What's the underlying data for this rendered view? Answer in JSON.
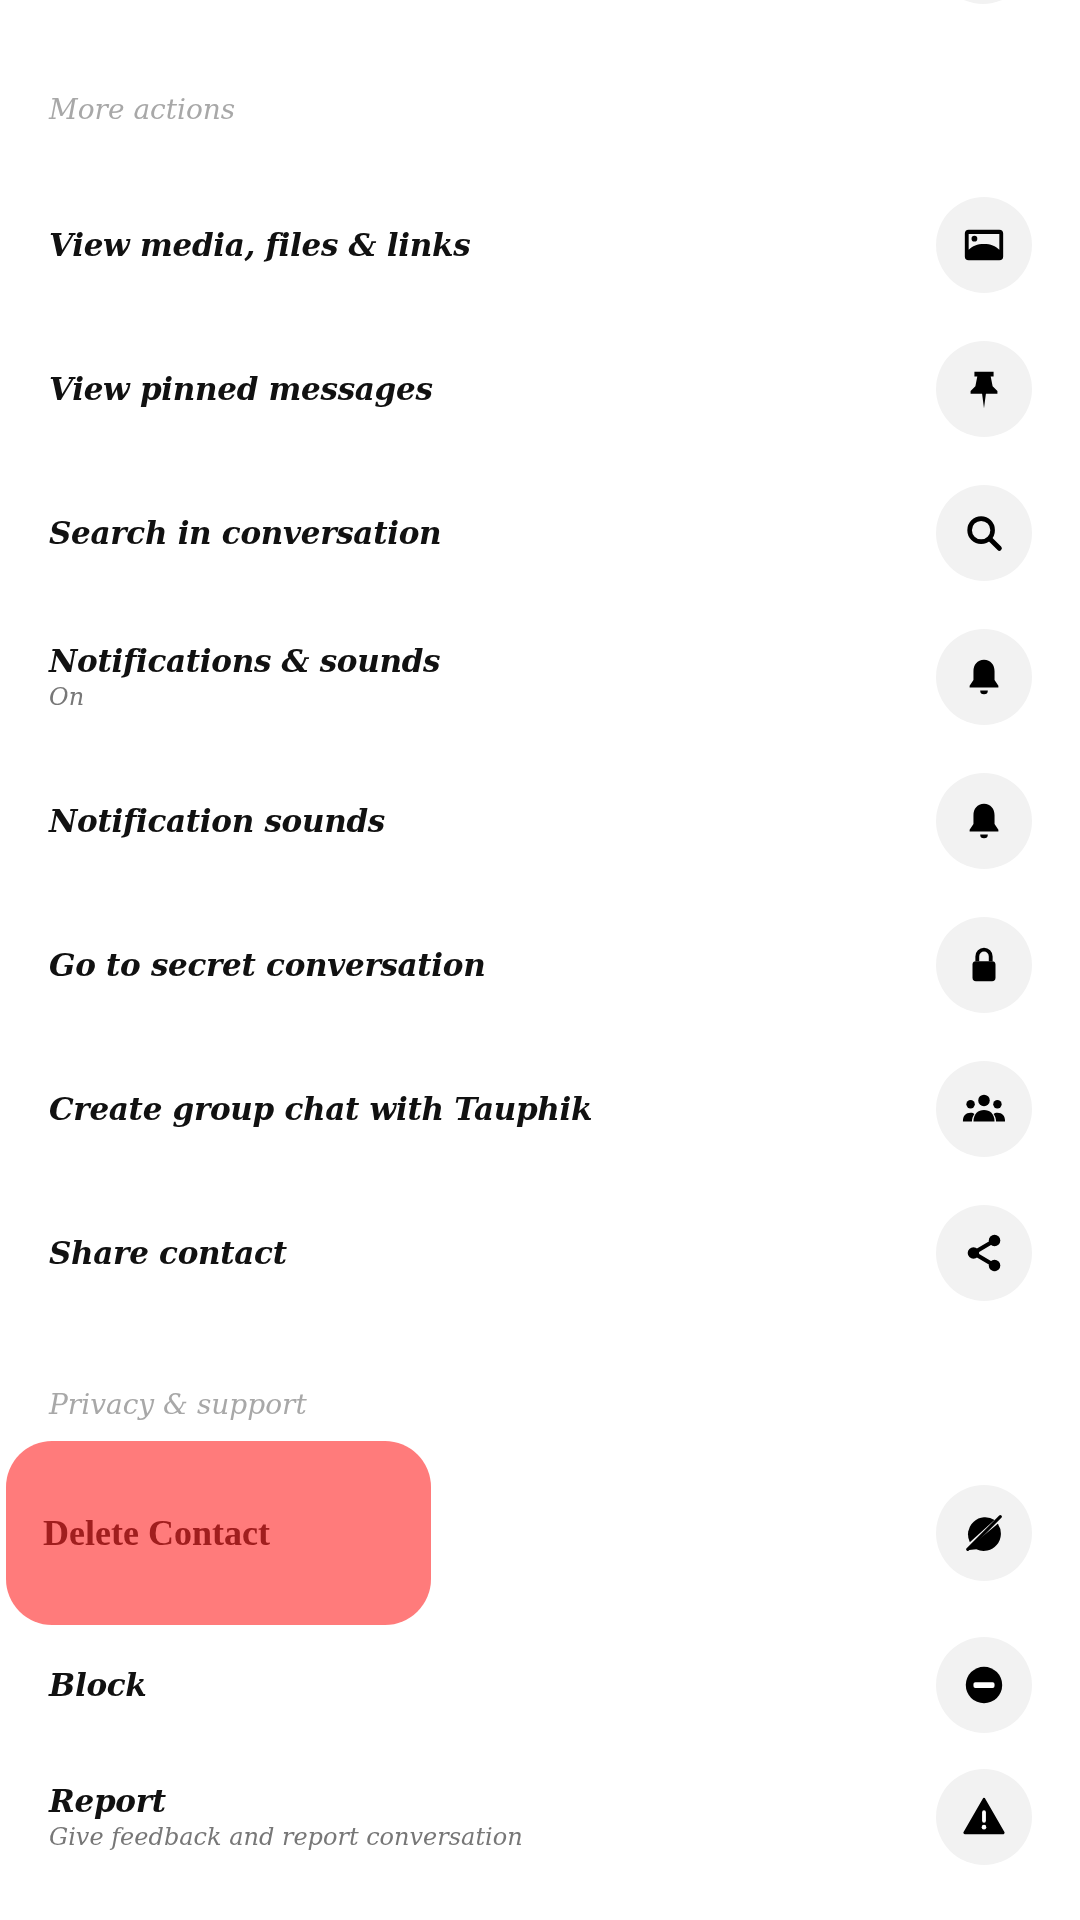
{
  "sections": [
    {
      "title": "More actions",
      "items": [
        {
          "kind": "row",
          "label": "View media, files & links"
        },
        {
          "kind": "row",
          "label": "View pinned messages"
        },
        {
          "kind": "row",
          "label": "Search in conversation"
        },
        {
          "kind": "row",
          "label": "Notifications & sounds",
          "subtitle": "On"
        },
        {
          "kind": "row",
          "label": "Notification sounds"
        },
        {
          "kind": "row",
          "label": "Go to secret conversation"
        },
        {
          "kind": "row",
          "label": "Create group chat with Tauphik"
        },
        {
          "kind": "row",
          "label": "Share contact"
        }
      ]
    },
    {
      "title": "Privacy & support",
      "items": [
        {
          "kind": "highlight",
          "label": "Delete Contact"
        },
        {
          "kind": "row",
          "label": "Block"
        },
        {
          "kind": "row",
          "label": "Report",
          "subtitle": "Give feedback and report conversation"
        }
      ]
    }
  ]
}
